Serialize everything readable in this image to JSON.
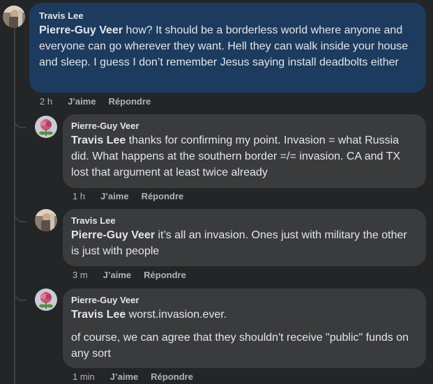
{
  "comments": [
    {
      "author": "Travis Lee",
      "mention": "Pierre-Guy Veer",
      "text": " how? It should be a borderless world where anyone and everyone can go wherever they want. Hell they can walk inside your house and sleep. I guess I don’t remember Jesus saying install deadbolts either",
      "time": "2 h",
      "like_label": "J’aime",
      "reply_label": "Répondre"
    },
    {
      "author": "Pierre-Guy Veer",
      "mention": "Travis Lee",
      "text": " thanks for confirming my point. Invasion = what Russia did. What happens at the southern border =/= invasion. CA and TX lost that argument at least twice already",
      "time": "1 h",
      "like_label": "J’aime",
      "reply_label": "Répondre"
    },
    {
      "author": "Travis Lee",
      "mention": "Pierre-Guy Veer",
      "text": " it’s all an invasion. Ones just with military the other is just with people",
      "time": "3 m",
      "like_label": "J’aime",
      "reply_label": "Répondre"
    },
    {
      "author": "Pierre-Guy Veer",
      "mention": "Travis Lee",
      "text": " worst.invasion.ever.",
      "text2": "of course, we can agree that they shouldn't receive \"public\" funds on any sort",
      "time": "1 min",
      "like_label": "J’aime",
      "reply_label": "Répondre"
    }
  ],
  "colors": {
    "background": "#242526",
    "highlight_bubble": "#1c3b5e",
    "bubble": "#3a3b3c",
    "muted_text": "#b0b3b8"
  }
}
